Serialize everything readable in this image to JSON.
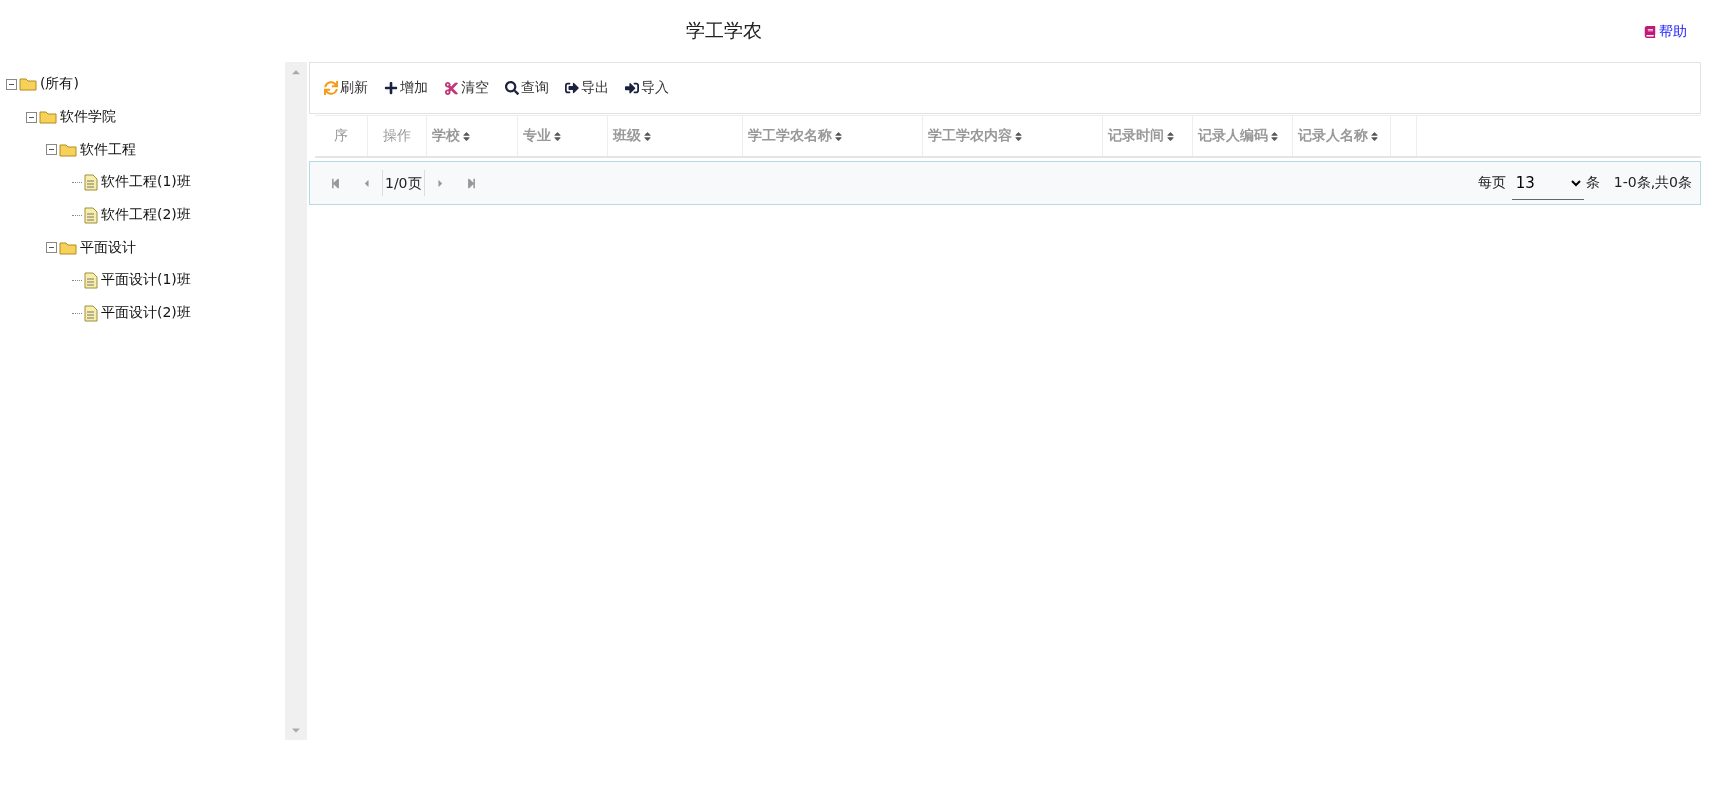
{
  "title": "学工学农",
  "help": {
    "label": "帮助"
  },
  "tree": [
    {
      "label": "(所有)",
      "expanded": true,
      "children": [
        {
          "label": "软件学院",
          "expanded": true,
          "children": [
            {
              "label": "软件工程",
              "expanded": true,
              "children": [
                {
                  "label": "软件工程(1)班"
                },
                {
                  "label": "软件工程(2)班"
                }
              ]
            },
            {
              "label": "平面设计",
              "expanded": true,
              "children": [
                {
                  "label": "平面设计(1)班"
                },
                {
                  "label": "平面设计(2)班"
                }
              ]
            }
          ]
        }
      ]
    }
  ],
  "toolbar": [
    {
      "kind": "refresh",
      "label": "刷新"
    },
    {
      "kind": "add",
      "label": "增加"
    },
    {
      "kind": "clear",
      "label": "清空"
    },
    {
      "kind": "search",
      "label": "查询"
    },
    {
      "kind": "export",
      "label": "导出"
    },
    {
      "kind": "import",
      "label": "导入"
    }
  ],
  "columns": [
    {
      "label": "序",
      "sortable": false
    },
    {
      "label": "操作",
      "sortable": false
    },
    {
      "label": "学校",
      "sortable": true
    },
    {
      "label": "专业",
      "sortable": true
    },
    {
      "label": "班级",
      "sortable": true
    },
    {
      "label": "学工学农名称",
      "sortable": true
    },
    {
      "label": "学工学农内容",
      "sortable": true
    },
    {
      "label": "记录时间",
      "sortable": true
    },
    {
      "label": "记录人编码",
      "sortable": true
    },
    {
      "label": "记录人名称",
      "sortable": true
    }
  ],
  "pager": {
    "page": "1/0页",
    "per_page_label": "每页",
    "per_page": "13",
    "unit": "条",
    "summary": "1-0条,共0条"
  }
}
